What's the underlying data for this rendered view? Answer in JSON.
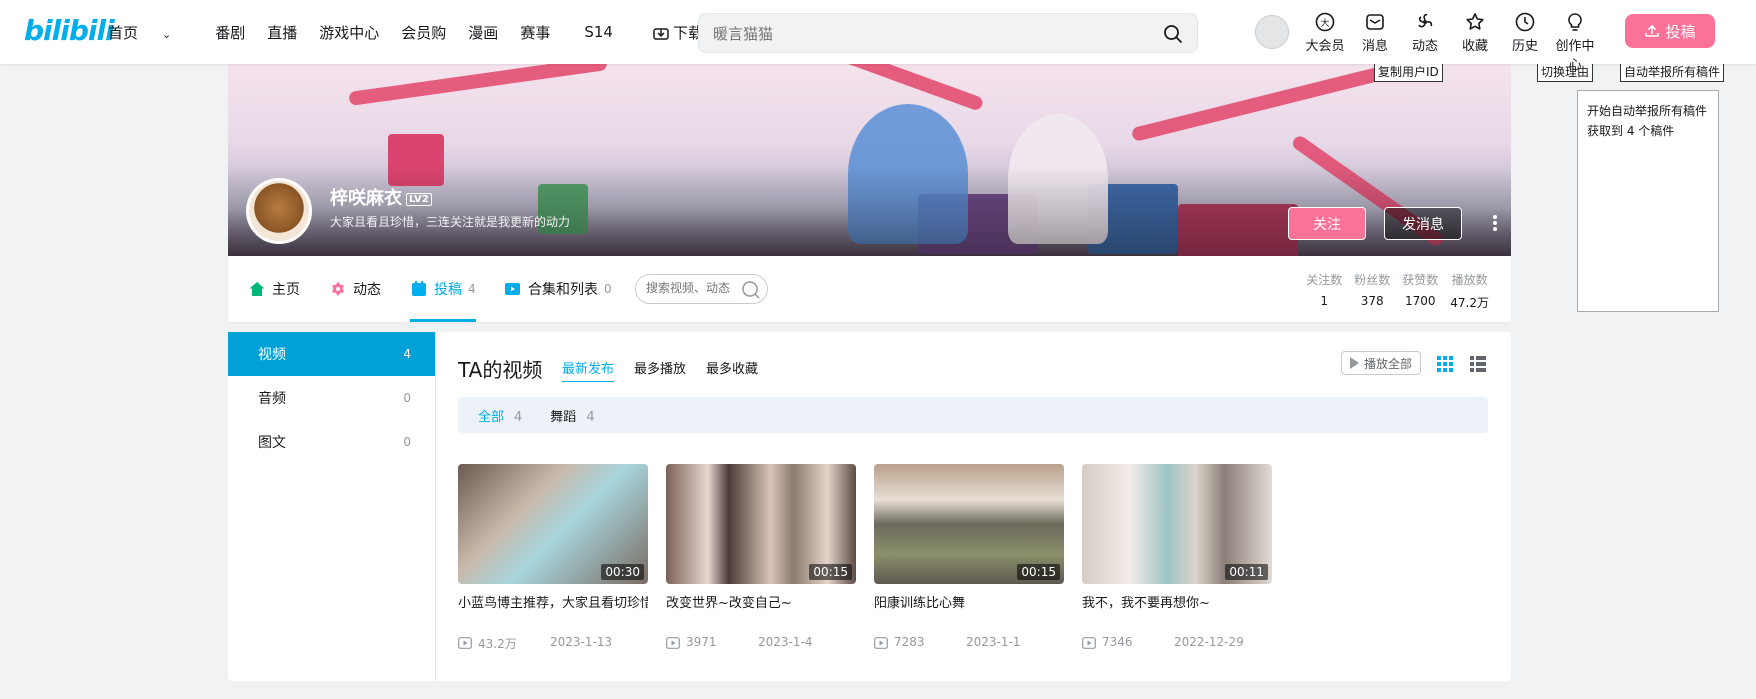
{
  "topbar": {
    "logo": "bilibili",
    "nav": [
      "首页",
      "番剧",
      "直播",
      "游戏中心",
      "会员购",
      "漫画",
      "赛事",
      "S14",
      "下载客户端"
    ],
    "search_placeholder": "暖言猫猫",
    "icons": [
      {
        "label": "大会员",
        "icon": "vip-icon"
      },
      {
        "label": "消息",
        "icon": "message-icon"
      },
      {
        "label": "动态",
        "icon": "dynamic-icon"
      },
      {
        "label": "收藏",
        "icon": "favorite-icon"
      },
      {
        "label": "历史",
        "icon": "history-icon"
      },
      {
        "label": "创作中心",
        "icon": "creator-icon"
      }
    ],
    "upload_label": "投稿"
  },
  "user": {
    "name": "梓咲麻衣",
    "level": "LV2",
    "sign": "大家且看且珍惜，三连关注就是我更新的动力",
    "follow_label": "关注",
    "message_label": "发消息"
  },
  "tabs": [
    {
      "label": "主页",
      "count": "",
      "icon": "home-icon"
    },
    {
      "label": "动态",
      "count": "",
      "icon": "dynamic-icon"
    },
    {
      "label": "投稿",
      "count": "4",
      "icon": "upload-icon"
    },
    {
      "label": "合集和列表",
      "count": "0",
      "icon": "collection-icon"
    }
  ],
  "tab_search_placeholder": "搜索视频、动态",
  "stats": [
    {
      "label": "关注数",
      "value": "1"
    },
    {
      "label": "粉丝数",
      "value": "378"
    },
    {
      "label": "获赞数",
      "value": "1700"
    },
    {
      "label": "播放数",
      "value": "47.2万"
    }
  ],
  "sidebar": [
    {
      "label": "视频",
      "count": "4"
    },
    {
      "label": "音频",
      "count": "0"
    },
    {
      "label": "图文",
      "count": "0"
    }
  ],
  "videos_section": {
    "title": "TA的视频",
    "sorts": [
      "最新发布",
      "最多播放",
      "最多收藏"
    ],
    "play_all": "播放全部",
    "filters": [
      {
        "label": "全部",
        "count": "4"
      },
      {
        "label": "舞蹈",
        "count": "4"
      }
    ]
  },
  "videos": [
    {
      "title": "小蓝鸟博主推荐，大家且看切珍惜~",
      "duration": "00:30",
      "plays": "43.2万",
      "date": "2023-1-13"
    },
    {
      "title": "改变世界~改变自己~",
      "duration": "00:15",
      "plays": "3971",
      "date": "2023-1-4"
    },
    {
      "title": "阳康训练比心舞",
      "duration": "00:15",
      "plays": "7283",
      "date": "2023-1-1"
    },
    {
      "title": "我不，我不要再想你~",
      "duration": "00:11",
      "plays": "7346",
      "date": "2022-12-29"
    }
  ],
  "extension": {
    "copy_id": "复制用户ID",
    "switch_reason": "切换理由",
    "auto_report": "自动举报所有稿件",
    "log": [
      "开始自动举报所有稿件",
      "获取到 4 个稿件"
    ]
  },
  "colors": {
    "brand": "#00aeec",
    "pink": "#fb7299",
    "sidebar_active": "#00a1d6"
  }
}
